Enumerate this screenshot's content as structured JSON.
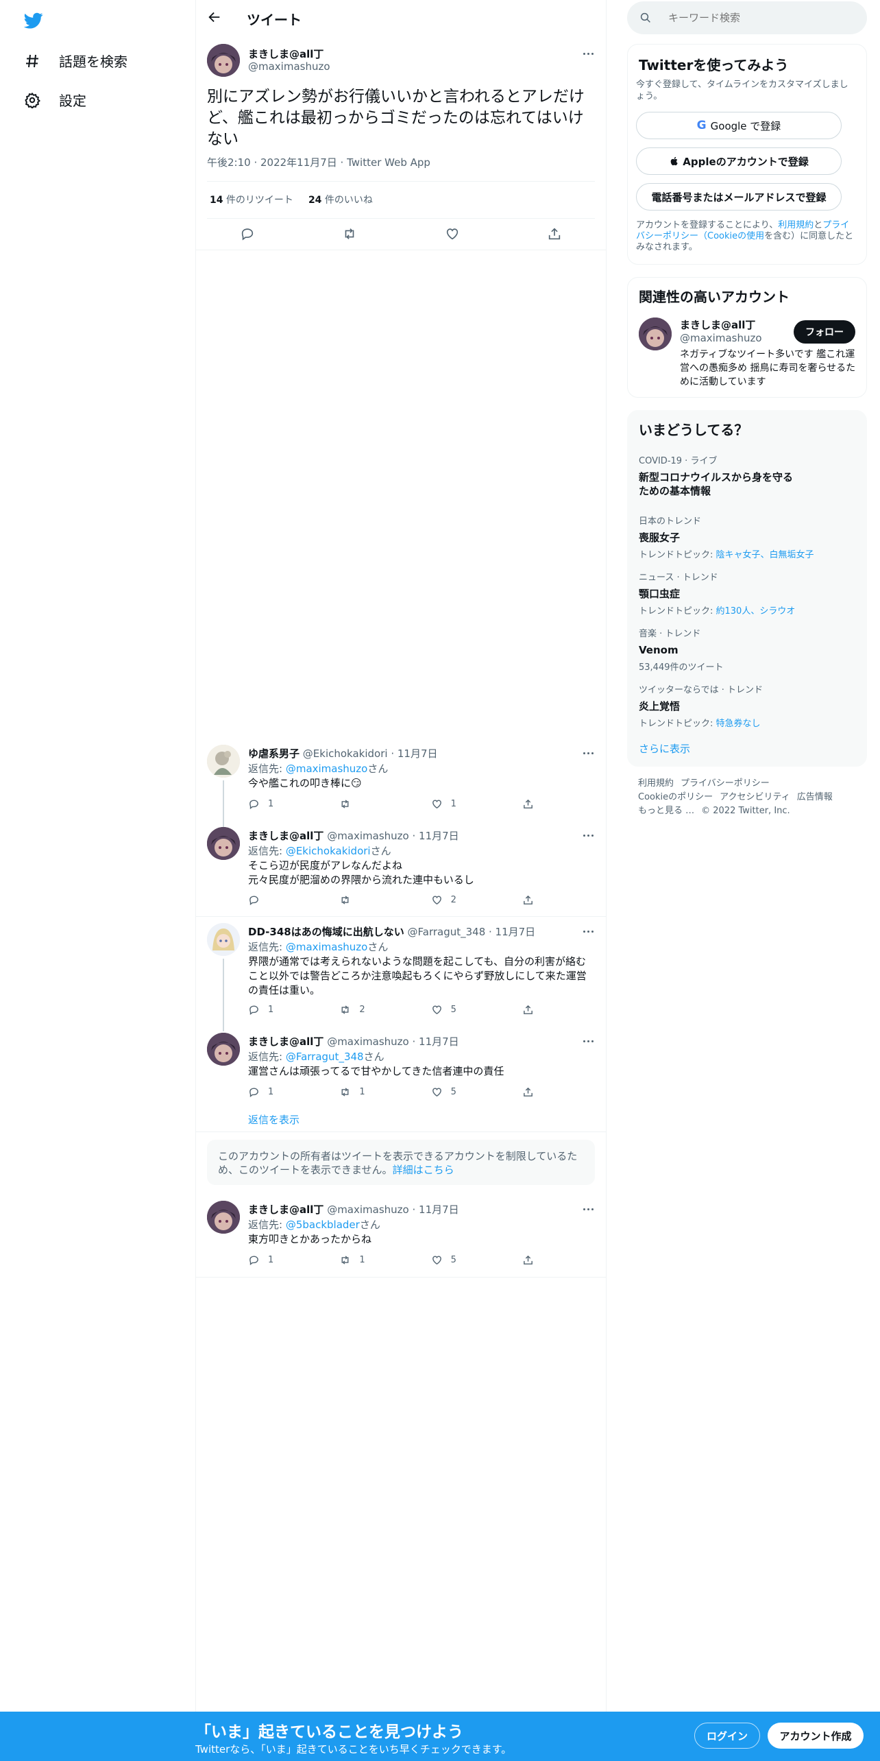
{
  "nav": {
    "explore_label": "話題を検索",
    "settings_label": "設定"
  },
  "header": {
    "title": "ツイート"
  },
  "main_tweet": {
    "name": "まきしま@all丁",
    "handle": "@maximashuzo",
    "text": "別にアズレン勢がお行儀いいかと言われるとアレだけど、艦これは最初っからゴミだったのは忘れてはいけない",
    "meta": "午後2:10 · 2022年11月7日 · Twitter Web App",
    "retweets_count": "14",
    "retweets_label": "件のリツイート",
    "likes_count": "24",
    "likes_label": "件のいいね"
  },
  "replies": [
    {
      "name": "ゆ虐系男子",
      "handle": "@Ekichokakidori · 11月7日",
      "to_prefix": "返信先: ",
      "to_user": "@maximashuzo",
      "to_suffix": "さん",
      "line1": "今や艦これの叩き棒に😏",
      "line2": "",
      "replies": "1",
      "retweets": "",
      "likes": "1"
    },
    {
      "name": "まきしま@all丁",
      "handle": "@maximashuzo · 11月7日",
      "to_prefix": "返信先: ",
      "to_user": "@Ekichokakidori",
      "to_suffix": "さん",
      "line1": "そこら辺が民度がアレなんだよね",
      "line2": "元々民度が肥溜めの界隈から流れた連中もいるし",
      "replies": "",
      "retweets": "",
      "likes": "2"
    },
    {
      "name": "DD-348はあの悔域に出航しない",
      "handle": "@Farragut_348 · 11月7日",
      "to_prefix": "返信先: ",
      "to_user": "@maximashuzo",
      "to_suffix": "さん",
      "line1": "界隈が通常では考えられないような問題を起こしても、自分の利害が絡むこと以外では警告どころか注意喚起もろくにやらず野放しにして来た運営の責任は重い。",
      "line2": "",
      "replies": "1",
      "retweets": "2",
      "likes": "5"
    },
    {
      "name": "まきしま@all丁",
      "handle": "@maximashuzo · 11月7日",
      "to_prefix": "返信先: ",
      "to_user": "@Farragut_348",
      "to_suffix": "さん",
      "line1": "運営さんは頑張ってるで甘やかしてきた信者連中の責任",
      "line2": "",
      "replies": "1",
      "retweets": "1",
      "likes": "5"
    },
    {
      "name": "まきしま@all丁",
      "handle": "@maximashuzo · 11月7日",
      "to_prefix": "返信先: ",
      "to_user": "@5backblader",
      "to_suffix": "さん",
      "line1": "東方叩きとかあったからね",
      "line2": "",
      "replies": "1",
      "retweets": "1",
      "likes": "5"
    }
  ],
  "show_replies_label": "返信を表示",
  "restricted": {
    "text": "このアカウントの所有者はツイートを表示できるアカウントを制限しているため、このツイートを表示できません。",
    "link": "詳細はこちら"
  },
  "search": {
    "placeholder": "キーワード検索"
  },
  "signup_card": {
    "title": "Twitterを使ってみよう",
    "desc": "今すぐ登録して、タイムラインをカスタマイズしましょう。",
    "google_label": "Google で登録",
    "apple_label": "Appleのアカウントで登録",
    "phone_label": "電話番号またはメールアドレスで登録",
    "terms_prefix": "アカウントを登録することにより、",
    "terms_link": "利用規約",
    "terms_and": "と",
    "privacy_link": "プライバシーポリシー（Cookieの使用",
    "terms_suffix": "を含む）に同意したとみなされます。"
  },
  "relevant": {
    "title": "関連性の高いアカウント",
    "name": "まきしま@all丁",
    "handle": "@maximashuzo",
    "follow_label": "フォロー",
    "bio": "ネガティブなツイート多いです 艦これ運営への愚痴多め 揺鳥に寿司を奢らせるために活動しています"
  },
  "trends": {
    "title": "いまどうしてる？",
    "items": [
      {
        "cat": "COVID-19 · ライブ",
        "title": "新型コロナウイルスから身を守るための基本情報",
        "sub_prefix": "",
        "sub_link": ""
      },
      {
        "cat": "日本のトレンド",
        "title": "喪服女子",
        "sub_prefix": "トレンドトピック: ",
        "sub_link": "陰キャ女子、白無垢女子"
      },
      {
        "cat": "ニュース · トレンド",
        "title": "顎口虫症",
        "sub_prefix": "トレンドトピック: ",
        "sub_link": "約130人、シラウオ"
      },
      {
        "cat": "音楽 · トレンド",
        "title": "Venom",
        "sub_prefix": "53,449件のツイート",
        "sub_link": ""
      },
      {
        "cat": "ツイッターならでは · トレンド",
        "title": "炎上覚悟",
        "sub_prefix": "トレンドトピック: ",
        "sub_link": "特急券なし"
      }
    ],
    "more_label": "さらに表示"
  },
  "footer": {
    "links": [
      "利用規約",
      "プライバシーポリシー",
      "Cookieのポリシー",
      "アクセシビリティ",
      "広告情報",
      "もっと見る …"
    ],
    "copyright": "© 2022 Twitter, Inc."
  },
  "bottom_bar": {
    "title": "「いま」起きていることを見つけよう",
    "subtitle": "Twitterなら、「いま」起きていることをいち早くチェックできます。",
    "login_label": "ログイン",
    "signup_label": "アカウント作成"
  },
  "colors": {
    "accent": "#1d9bf0",
    "text": "#0f1419",
    "muted": "#536471",
    "border": "#eff3f4"
  }
}
